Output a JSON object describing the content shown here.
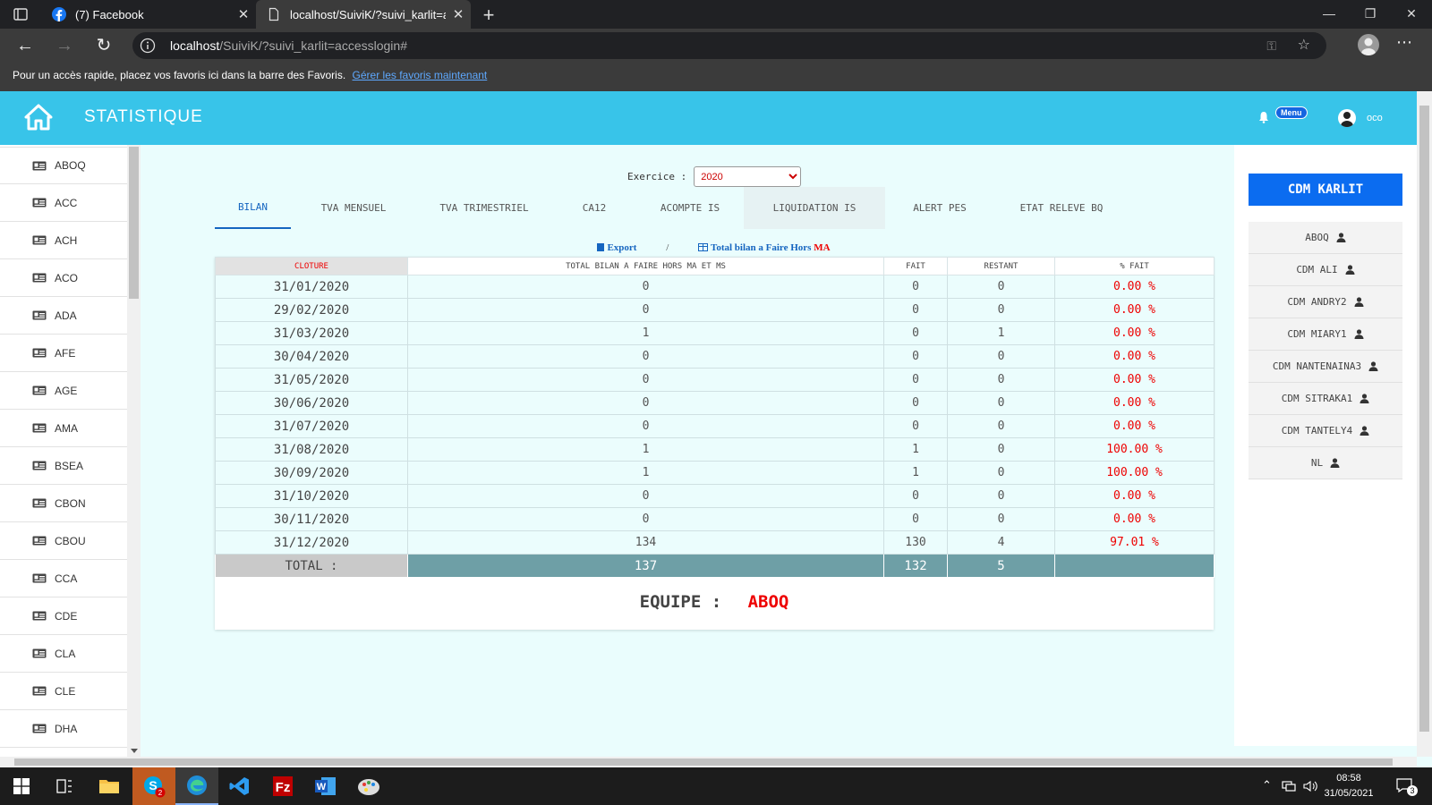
{
  "browser": {
    "tabs": [
      {
        "title": "(7) Facebook"
      },
      {
        "title": "localhost/SuiviK/?suivi_karlit=acc"
      }
    ],
    "url_host": "localhost",
    "url_path": "/SuiviK/?suivi_karlit=accesslogin#",
    "favorites_text": "Pour un accès rapide, placez vos favoris ici dans la barre des Favoris.",
    "favorites_link": "Gérer les favoris maintenant"
  },
  "header": {
    "title": "STATISTIQUE",
    "menu_badge": "Menu",
    "user": "oco"
  },
  "sidebar": {
    "items": [
      "ABOQ",
      "ACC",
      "ACH",
      "ACO",
      "ADA",
      "AFE",
      "AGE",
      "AMA",
      "BSEA",
      "CBON",
      "CBOU",
      "CCA",
      "CDE",
      "CLA",
      "CLE",
      "DHA"
    ]
  },
  "exercice": {
    "label": "Exercice :",
    "selected": "2020"
  },
  "tabs": [
    {
      "label": "BILAN",
      "active": true
    },
    {
      "label": "TVA MENSUEL"
    },
    {
      "label": "TVA TRIMESTRIEL"
    },
    {
      "label": "CA12"
    },
    {
      "label": "ACOMPTE IS"
    },
    {
      "label": "LIQUIDATION IS",
      "hover": true
    },
    {
      "label": "ALERT PES"
    },
    {
      "label": "ETAT RELEVE BQ"
    }
  ],
  "export": {
    "export_label": "Export",
    "separator": "/",
    "total_label": "Total bilan a Faire Hors",
    "total_label_ma": "MA"
  },
  "table": {
    "headers": [
      "CLOTURE",
      "TOTAL BILAN A FAIRE HORS MA ET MS",
      "FAIT",
      "RESTANT",
      "% FAIT"
    ],
    "rows": [
      [
        "31/01/2020",
        "0",
        "0",
        "0",
        "0.00 %"
      ],
      [
        "29/02/2020",
        "0",
        "0",
        "0",
        "0.00 %"
      ],
      [
        "31/03/2020",
        "1",
        "0",
        "1",
        "0.00 %"
      ],
      [
        "30/04/2020",
        "0",
        "0",
        "0",
        "0.00 %"
      ],
      [
        "31/05/2020",
        "0",
        "0",
        "0",
        "0.00 %"
      ],
      [
        "30/06/2020",
        "0",
        "0",
        "0",
        "0.00 %"
      ],
      [
        "31/07/2020",
        "0",
        "0",
        "0",
        "0.00 %"
      ],
      [
        "31/08/2020",
        "1",
        "1",
        "0",
        "100.00 %"
      ],
      [
        "30/09/2020",
        "1",
        "1",
        "0",
        "100.00 %"
      ],
      [
        "31/10/2020",
        "0",
        "0",
        "0",
        "0.00 %"
      ],
      [
        "30/11/2020",
        "0",
        "0",
        "0",
        "0.00 %"
      ],
      [
        "31/12/2020",
        "134",
        "130",
        "4",
        "97.01 %"
      ]
    ],
    "total": {
      "label": "TOTAL :",
      "bilan": "137",
      "fait": "132",
      "restant": "5",
      "pct": ""
    }
  },
  "equipe": {
    "label": "EQUIPE :",
    "team": "ABOQ"
  },
  "right_panel": {
    "button": "CDM KARLIT",
    "members": [
      "ABOQ",
      "CDM ALI",
      "CDM ANDRY2",
      "CDM MIARY1",
      "CDM NANTENAINA3",
      "CDM SITRAKA1",
      "CDM TANTELY4",
      "NL"
    ]
  },
  "taskbar": {
    "time": "08:58",
    "date": "31/05/2021",
    "notification_count": "3",
    "skype_badge": "2"
  },
  "colors": {
    "header_bg": "#38c4e9",
    "content_bg": "#eafdfd",
    "accent_blue": "#0b6cf0",
    "alert_red": "#e00000",
    "total_row": "#6e9fa6"
  }
}
